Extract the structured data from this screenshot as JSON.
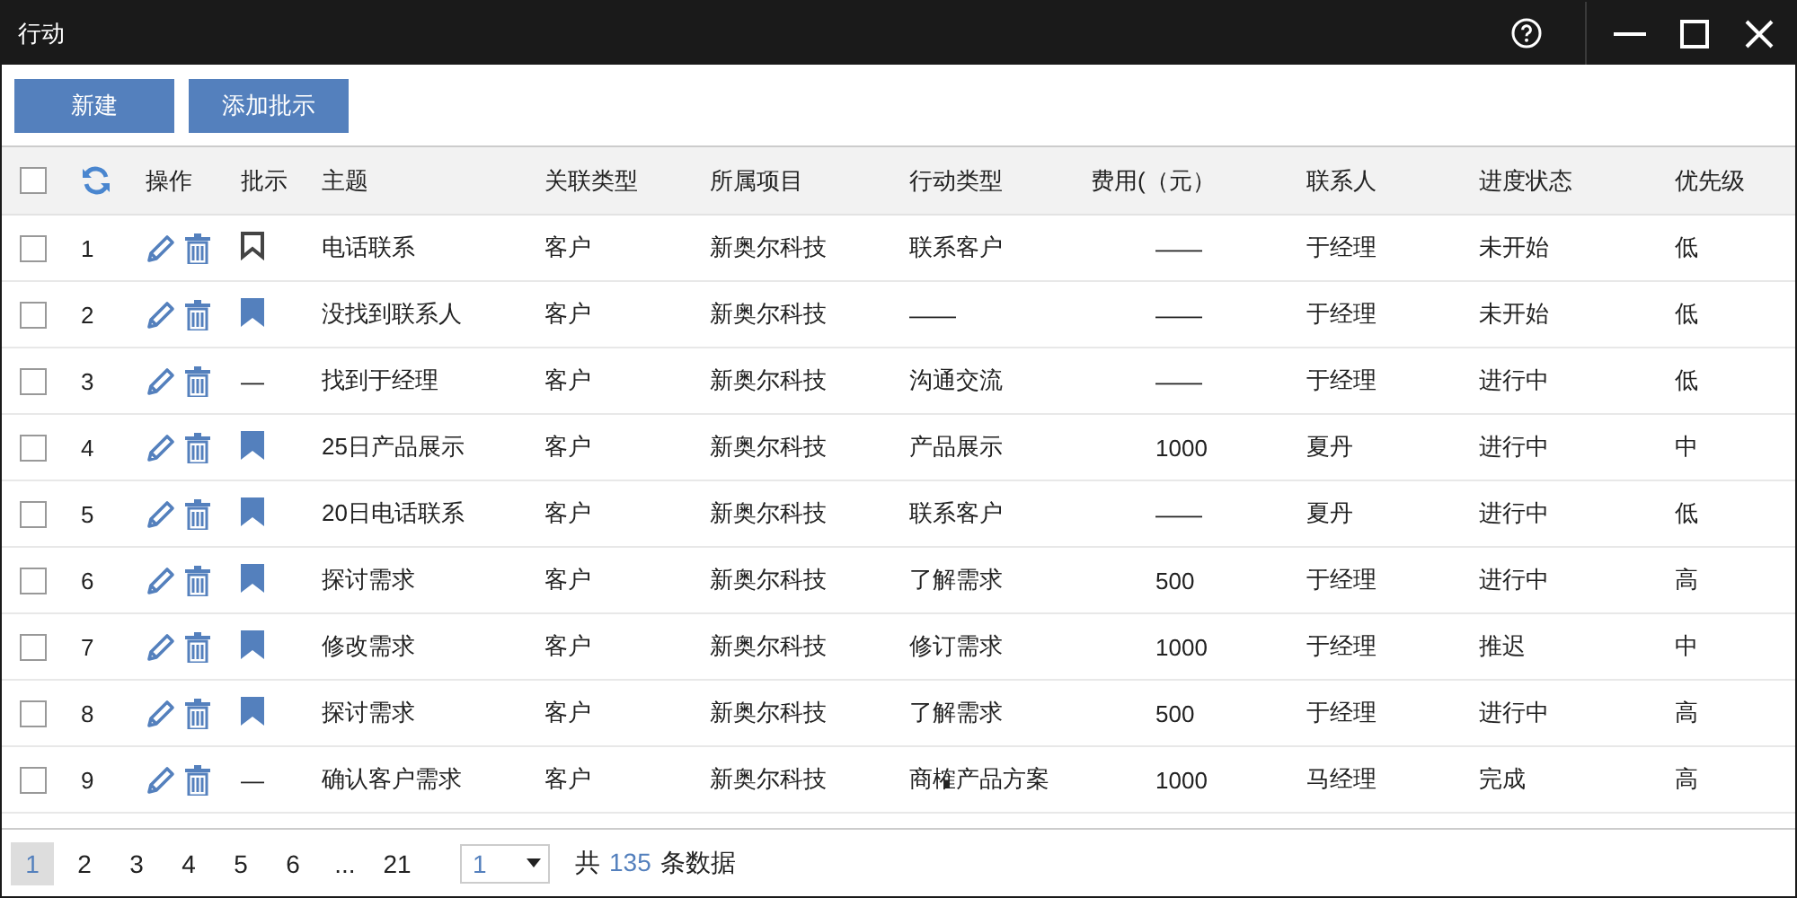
{
  "window": {
    "title": "行动"
  },
  "toolbar": {
    "buttons": [
      "新建",
      "添加批示"
    ]
  },
  "table": {
    "all_checked": false,
    "columns": [
      "操作",
      "批示",
      "主题",
      "关联类型",
      "所属项目",
      "行动类型",
      "费用(（元）",
      "联系人",
      "进度状态",
      "优先级"
    ],
    "rows": [
      {
        "checked": false,
        "index": "1",
        "annotation": {
          "kind": "mark",
          "filled": false
        },
        "subject": "电话联系",
        "related_type": "客户",
        "project": "新奥尔科技",
        "action_type": "联系客户",
        "cost": "——",
        "contact": "于经理",
        "status": "未开始",
        "priority": "低"
      },
      {
        "checked": false,
        "index": "2",
        "annotation": {
          "kind": "mark",
          "filled": true
        },
        "subject": "没找到联系人",
        "related_type": "客户",
        "project": "新奥尔科技",
        "action_type": "——",
        "cost": "——",
        "contact": "于经理",
        "status": "未开始",
        "priority": "低"
      },
      {
        "checked": false,
        "index": "3",
        "annotation": {
          "kind": "text",
          "text": "—"
        },
        "subject": "找到于经理",
        "related_type": "客户",
        "project": "新奥尔科技",
        "action_type": "沟通交流",
        "cost": "——",
        "contact": "于经理",
        "status": "进行中",
        "priority": "低"
      },
      {
        "checked": false,
        "index": "4",
        "annotation": {
          "kind": "mark",
          "filled": true
        },
        "subject": "25日产品展示",
        "related_type": "客户",
        "project": "新奥尔科技",
        "action_type": "产品展示",
        "cost": "1000",
        "contact": "夏丹",
        "status": "进行中",
        "priority": "中"
      },
      {
        "checked": false,
        "index": "5",
        "annotation": {
          "kind": "mark",
          "filled": true
        },
        "subject": "20日电话联系",
        "related_type": "客户",
        "project": "新奥尔科技",
        "action_type": "联系客户",
        "cost": "——",
        "contact": "夏丹",
        "status": "进行中",
        "priority": "低"
      },
      {
        "checked": false,
        "index": "6",
        "annotation": {
          "kind": "mark",
          "filled": true
        },
        "subject": "探讨需求",
        "related_type": "客户",
        "project": "新奥尔科技",
        "action_type": "了解需求",
        "cost": "500",
        "contact": "于经理",
        "status": "进行中",
        "priority": "高"
      },
      {
        "checked": false,
        "index": "7",
        "annotation": {
          "kind": "mark",
          "filled": true
        },
        "subject": "修改需求",
        "related_type": "客户",
        "project": "新奥尔科技",
        "action_type": "修订需求",
        "cost": "1000",
        "contact": "于经理",
        "status": "推迟",
        "priority": "中"
      },
      {
        "checked": false,
        "index": "8",
        "annotation": {
          "kind": "mark",
          "filled": true
        },
        "subject": "探讨需求",
        "related_type": "客户",
        "project": "新奥尔科技",
        "action_type": "了解需求",
        "cost": "500",
        "contact": "于经理",
        "status": "进行中",
        "priority": "高"
      },
      {
        "checked": false,
        "index": "9",
        "annotation": {
          "kind": "text",
          "text": "—"
        },
        "subject": "确认客户需求",
        "related_type": "客户",
        "project": "新奥尔科技",
        "action_type": "商榷产品方案",
        "cost": "1000",
        "contact": "马经理",
        "status": "完成",
        "priority": "高"
      }
    ]
  },
  "pagination": {
    "pages": [
      {
        "label": "1",
        "selected": true
      },
      {
        "label": "2",
        "selected": false
      },
      {
        "label": "3",
        "selected": false
      },
      {
        "label": "4",
        "selected": false
      },
      {
        "label": "5",
        "selected": false
      },
      {
        "label": "6",
        "selected": false
      },
      {
        "label": "...",
        "selected": false
      },
      {
        "label": "21",
        "selected": false
      }
    ],
    "page_select": "1",
    "total_prefix": "共",
    "total": "135",
    "total_suffix": "条数据"
  }
}
